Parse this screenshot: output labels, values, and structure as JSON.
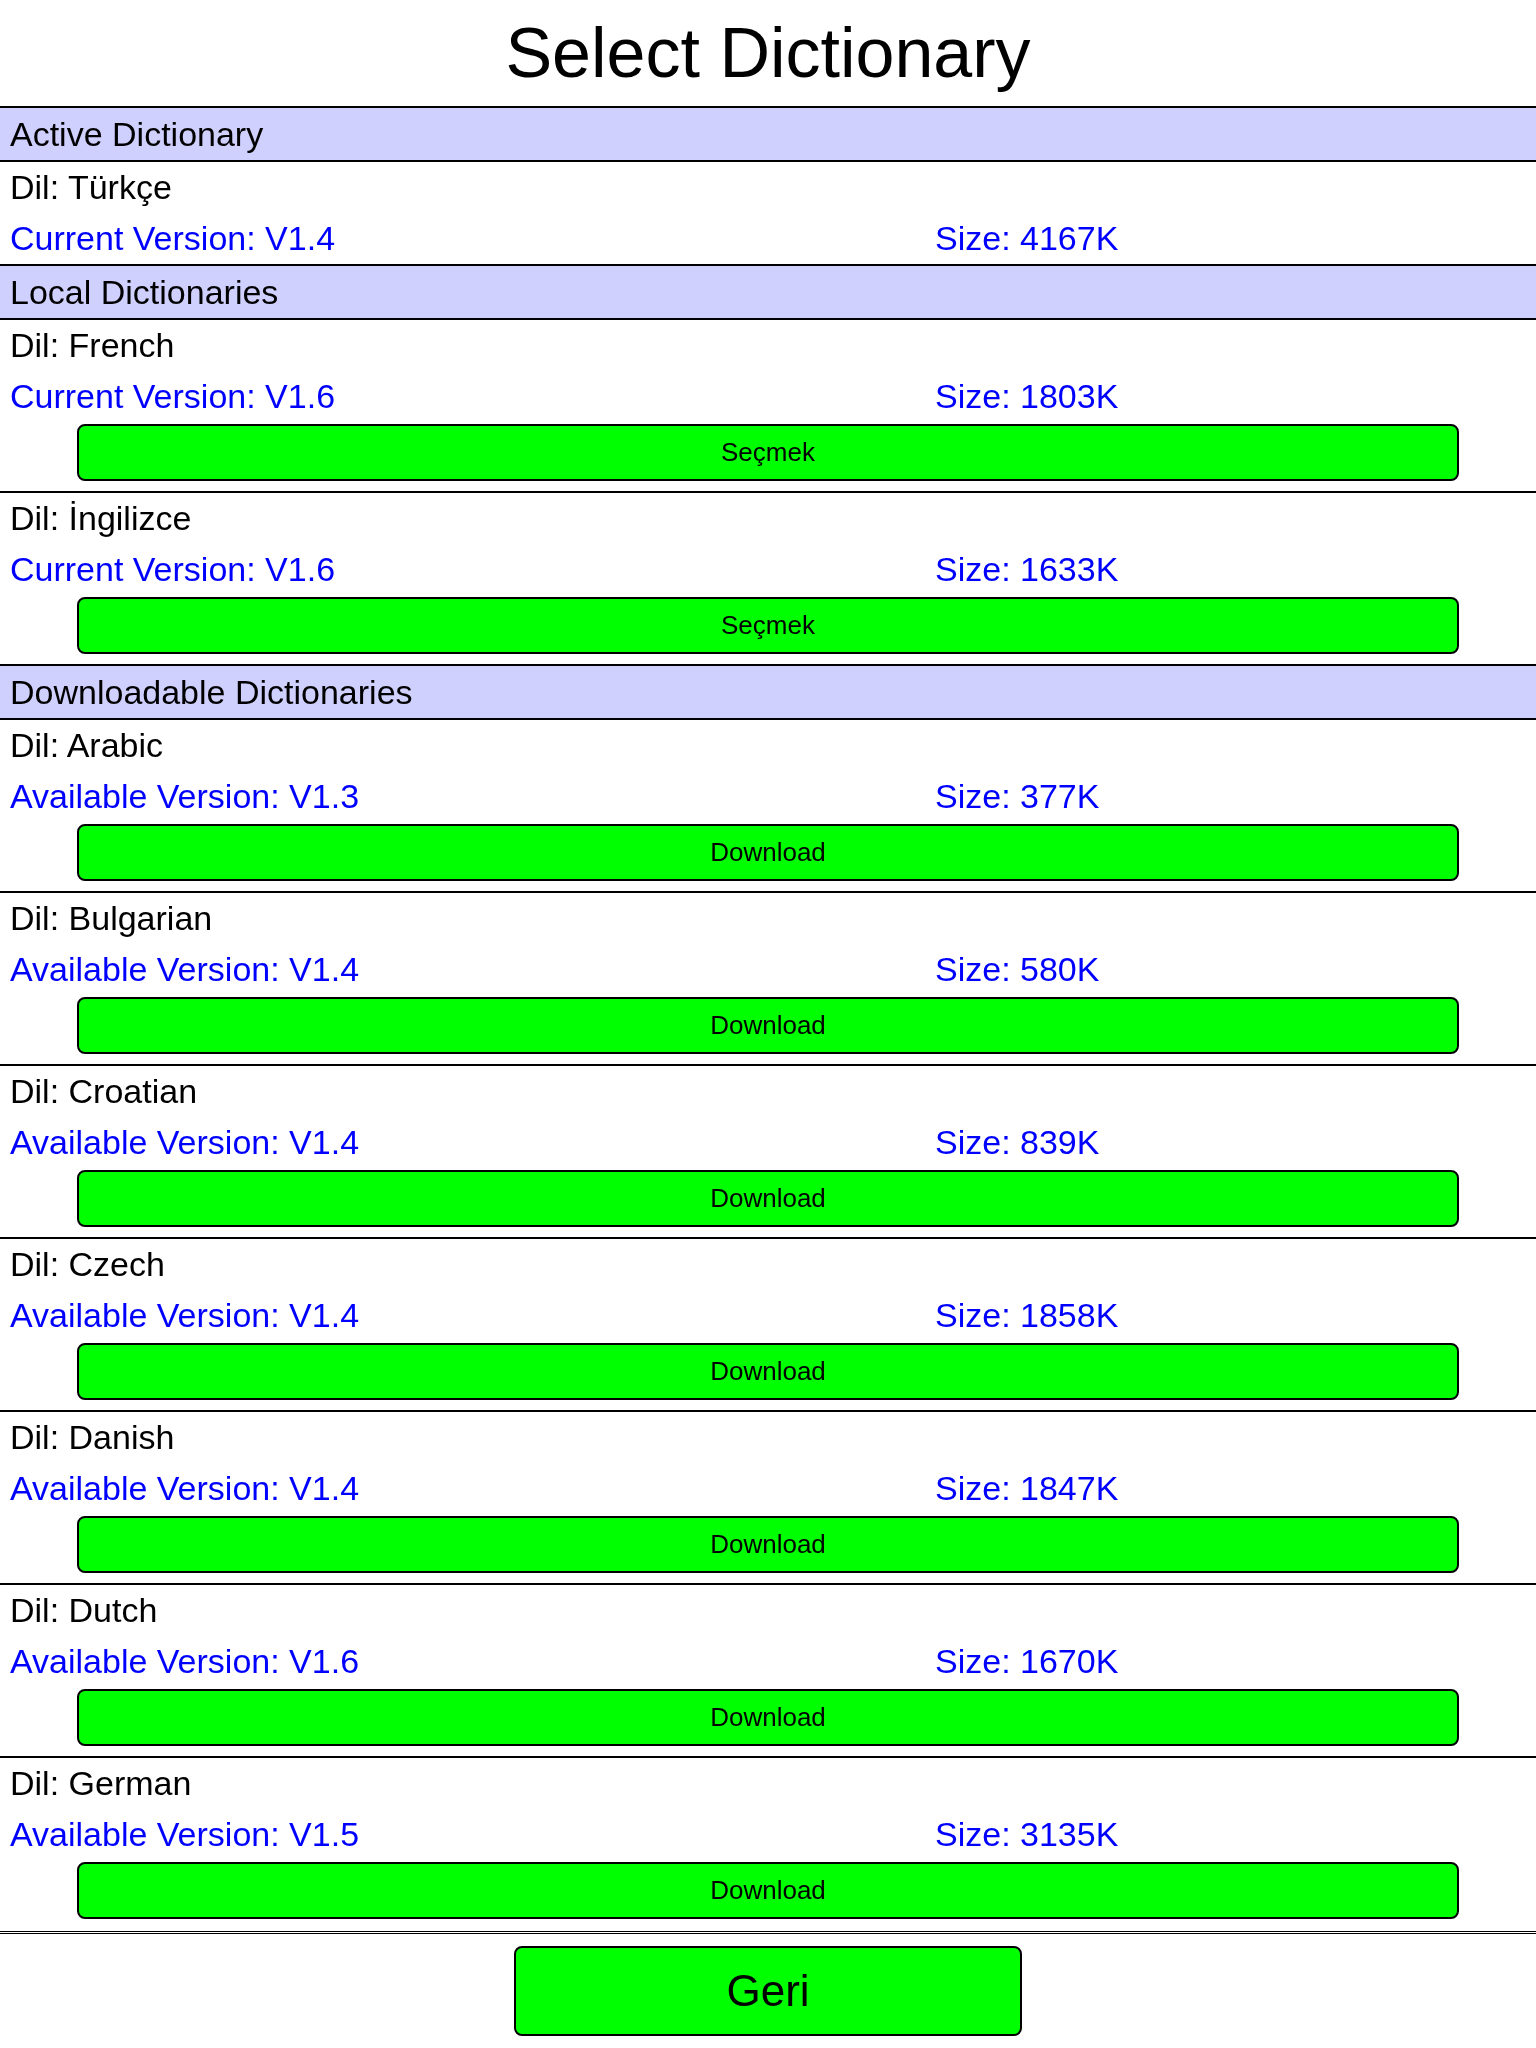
{
  "title": "Select Dictionary",
  "sections": [
    {
      "title": "Active Dictionary",
      "items": [
        {
          "language": "Dil: Türkçe",
          "version": "Current Version: V1.4",
          "size": "Size: 4167K"
        }
      ]
    },
    {
      "title": "Local Dictionaries",
      "items": [
        {
          "language": "Dil: French",
          "version": "Current Version: V1.6",
          "size": "Size: 1803K",
          "button": "Seçmek"
        },
        {
          "language": "Dil: İngilizce",
          "version": "Current Version: V1.6",
          "size": "Size: 1633K",
          "button": "Seçmek"
        }
      ]
    },
    {
      "title": "Downloadable Dictionaries",
      "items": [
        {
          "language": "Dil: Arabic",
          "version": "Available Version: V1.3",
          "size": "Size: 377K",
          "button": "Download"
        },
        {
          "language": "Dil: Bulgarian",
          "version": "Available Version: V1.4",
          "size": "Size: 580K",
          "button": "Download"
        },
        {
          "language": "Dil: Croatian",
          "version": "Available Version: V1.4",
          "size": "Size: 839K",
          "button": "Download"
        },
        {
          "language": "Dil: Czech",
          "version": "Available Version: V1.4",
          "size": "Size: 1858K",
          "button": "Download"
        },
        {
          "language": "Dil: Danish",
          "version": "Available Version: V1.4",
          "size": "Size: 1847K",
          "button": "Download"
        },
        {
          "language": "Dil: Dutch",
          "version": "Available Version: V1.6",
          "size": "Size: 1670K",
          "button": "Download"
        },
        {
          "language": "Dil: German",
          "version": "Available Version: V1.5",
          "size": "Size: 3135K",
          "button": "Download"
        }
      ]
    }
  ],
  "back_button": "Geri"
}
